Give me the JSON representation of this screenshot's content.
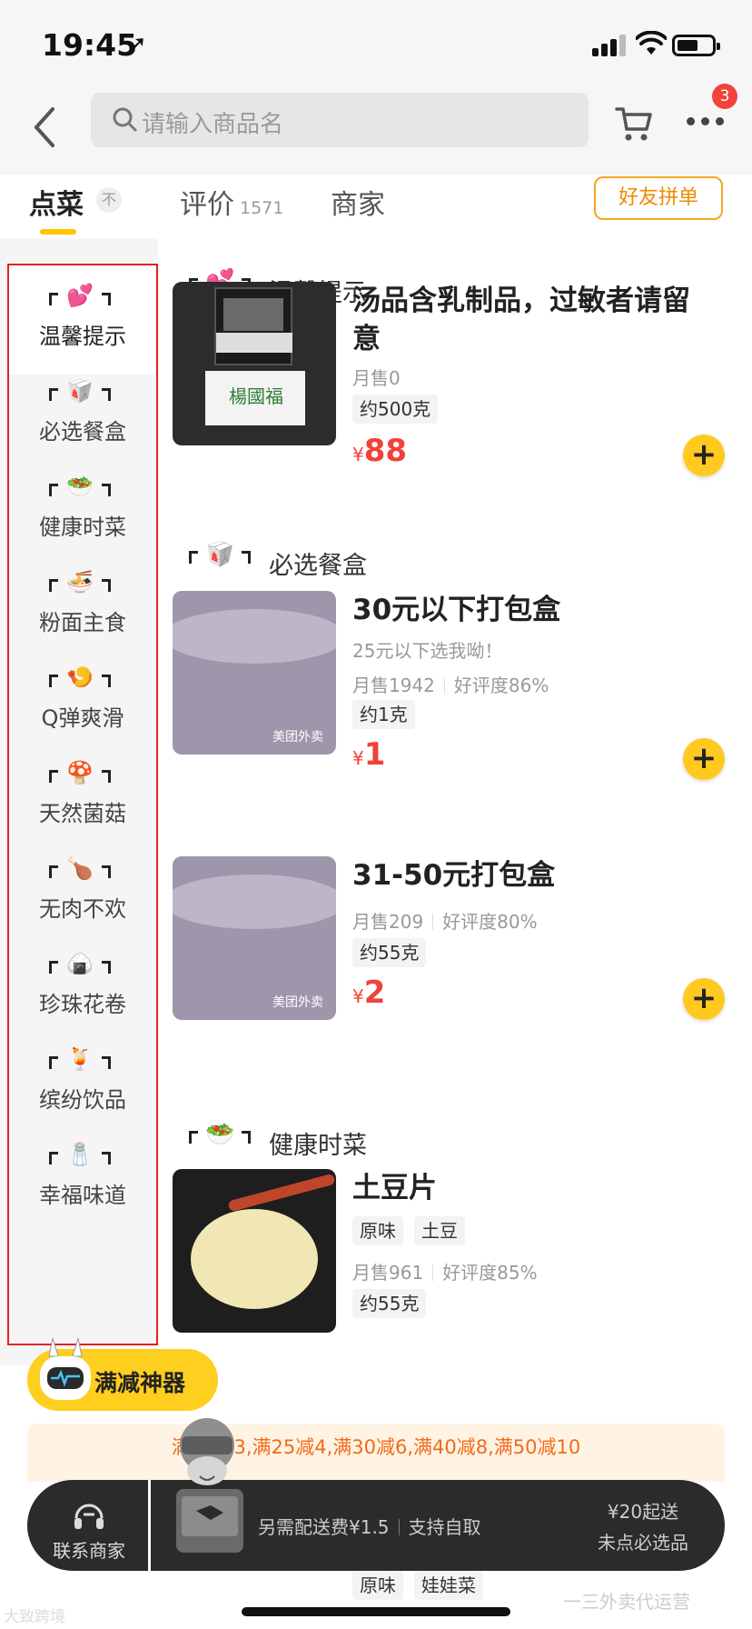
{
  "status": {
    "time": "19:45",
    "location_arrow": "➚",
    "signal_bars_filled": 3,
    "battery_level": 0.6
  },
  "nav": {
    "search_placeholder": "请输入商品名",
    "more_badge": "3"
  },
  "tabs": {
    "order": "点菜",
    "collapse": "不",
    "reviews": "评价",
    "reviews_count": "1571",
    "store": "商家",
    "group_order": "好友拼单"
  },
  "sidebar": {
    "items": [
      {
        "label": "温馨提示",
        "emoji": "💕",
        "icon": "hearts-icon",
        "active": true
      },
      {
        "label": "必选餐盒",
        "emoji": "🥡",
        "icon": "takeout-box-icon"
      },
      {
        "label": "健康时菜",
        "emoji": "🥗",
        "icon": "salad-icon"
      },
      {
        "label": "粉面主食",
        "emoji": "🍜",
        "icon": "noodle-bowl-icon"
      },
      {
        "label": "Q弹爽滑",
        "emoji": "🍤",
        "icon": "shrimp-icon"
      },
      {
        "label": "天然菌菇",
        "emoji": "🍄",
        "icon": "mushroom-icon"
      },
      {
        "label": "无肉不欢",
        "emoji": "🍗",
        "icon": "drumstick-icon"
      },
      {
        "label": "珍珠花卷",
        "emoji": "🍙",
        "icon": "rice-ball-icon"
      },
      {
        "label": "缤纷饮品",
        "emoji": "🍹",
        "icon": "drink-icon"
      },
      {
        "label": "幸福味道",
        "emoji": "🧂",
        "icon": "salt-shaker-icon"
      }
    ]
  },
  "sections": [
    {
      "title": "温馨提示",
      "emoji": "💕",
      "items": [
        {
          "name": "汤品含乳制品，过敏者请留意",
          "monthly": "月售0",
          "weight": "约500克",
          "currency": "¥",
          "price": "88",
          "thumb_text": "楊國福"
        }
      ]
    },
    {
      "title": "必选餐盒",
      "emoji": "🥡",
      "items": [
        {
          "name": "30元以下打包盒",
          "desc": "25元以下选我呦！",
          "monthly": "月售1942",
          "rating": "好评度86%",
          "weight": "约1克",
          "currency": "¥",
          "price": "1",
          "thumb_text": "美团外卖"
        },
        {
          "name": "31-50元打包盒",
          "monthly": "月售209",
          "rating": "好评度80%",
          "weight": "约55克",
          "currency": "¥",
          "price": "2",
          "thumb_text": "美团外卖"
        }
      ]
    },
    {
      "title": "健康时菜",
      "emoji": "🥗",
      "items": [
        {
          "name": "土豆片",
          "tags": [
            "原味",
            "土豆"
          ],
          "monthly": "月售961",
          "rating": "好评度85%",
          "weight": "约55克"
        }
      ]
    }
  ],
  "promo": {
    "label": "满减神器"
  },
  "discounts": "满20减3,满25减4,满30减6,满40减8,满50减10",
  "cartbar": {
    "contact": "联系商家",
    "delivery_fee": "另需配送费¥1.5",
    "pickup": "支持自取",
    "min_order": "¥20起送",
    "required_note": "未点必选品"
  },
  "below_tags": [
    "原味",
    "娃娃菜"
  ],
  "watermarks": {
    "left": "大致跨境",
    "right": "一三外卖代运营"
  },
  "colors": {
    "accent": "#ffc91f",
    "price": "#f0413a",
    "discount": "#f26a1b",
    "highlight_frame": "#e32222"
  }
}
